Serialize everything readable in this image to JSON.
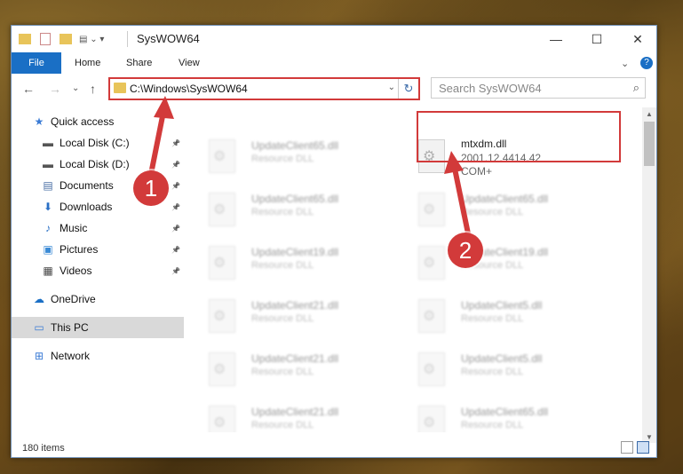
{
  "window": {
    "title": "SysWOW64",
    "minimize": "—",
    "maximize": "☐",
    "close": "✕"
  },
  "ribbon": {
    "file": "File",
    "home": "Home",
    "share": "Share",
    "view": "View",
    "expand": "⌄",
    "help": "?"
  },
  "nav": {
    "back": "←",
    "forward": "→",
    "recent": "⌄",
    "up": "↑",
    "address": "C:\\Windows\\SysWOW64",
    "address_dropdown": "⌄",
    "refresh": "↻",
    "search_placeholder": "Search SysWOW64",
    "search_icon": "⌕"
  },
  "sidebar": {
    "items": [
      {
        "label": "Quick access",
        "icon": "★",
        "icon_name": "star-icon",
        "color": "#3a7bd5"
      },
      {
        "label": "Local Disk (C:)",
        "icon": "▬",
        "icon_name": "drive-icon",
        "color": "#555555",
        "pin": "📌"
      },
      {
        "label": "Local Disk (D:)",
        "icon": "▬",
        "icon_name": "drive-icon",
        "color": "#555555",
        "pin": "📌"
      },
      {
        "label": "Documents",
        "icon": "▤",
        "icon_name": "documents-icon",
        "color": "#4a6fa5",
        "pin": "📌"
      },
      {
        "label": "Downloads",
        "icon": "⬇",
        "icon_name": "download-icon",
        "color": "#2a6fc5",
        "pin": "📌"
      },
      {
        "label": "Music",
        "icon": "♪",
        "icon_name": "music-icon",
        "color": "#2a6fc5",
        "pin": "📌"
      },
      {
        "label": "Pictures",
        "icon": "▣",
        "icon_name": "pictures-icon",
        "color": "#3a8ad5",
        "pin": "📌"
      },
      {
        "label": "Videos",
        "icon": "▦",
        "icon_name": "video-icon",
        "color": "#444444",
        "pin": "📌"
      },
      {
        "label": "OneDrive",
        "icon": "☁",
        "icon_name": "cloud-icon",
        "color": "#1a6fc5"
      },
      {
        "label": "This PC",
        "icon": "▭",
        "icon_name": "computer-icon",
        "color": "#3a7bd5",
        "selected": true
      },
      {
        "label": "Network",
        "icon": "⊞",
        "icon_name": "network-icon",
        "color": "#3a7bd5"
      }
    ]
  },
  "files": {
    "left": [
      {
        "name": "UpdateClient65.dll",
        "type": "Resource DLL"
      },
      {
        "name": "UpdateClient65.dll",
        "type": "Resource DLL"
      },
      {
        "name": "UpdateClient19.dll",
        "type": "Resource DLL"
      },
      {
        "name": "UpdateClient21.dll",
        "type": "Resource DLL"
      },
      {
        "name": "UpdateClient21.dll",
        "type": "Resource DLL"
      },
      {
        "name": "UpdateClient21.dll",
        "type": "Resource DLL"
      }
    ],
    "right": [
      {
        "name": "UpdateClient65.dll",
        "type": "Resource DLL"
      },
      {
        "name": "UpdateClient19.dll",
        "type": "Resource DLL"
      },
      {
        "name": "UpdateClient5.dll",
        "type": "Resource DLL"
      },
      {
        "name": "UpdateClient5.dll",
        "type": "Resource DLL"
      },
      {
        "name": "UpdateClient65.dll",
        "type": "Resource DLL"
      }
    ],
    "highlighted": {
      "name": "mtxdm.dll",
      "version": "2001.12.4414.42",
      "kind": "COM+"
    }
  },
  "status": {
    "items": "180 items"
  },
  "annotations": {
    "step1": "1",
    "step2": "2",
    "color": "#d23a3a"
  }
}
